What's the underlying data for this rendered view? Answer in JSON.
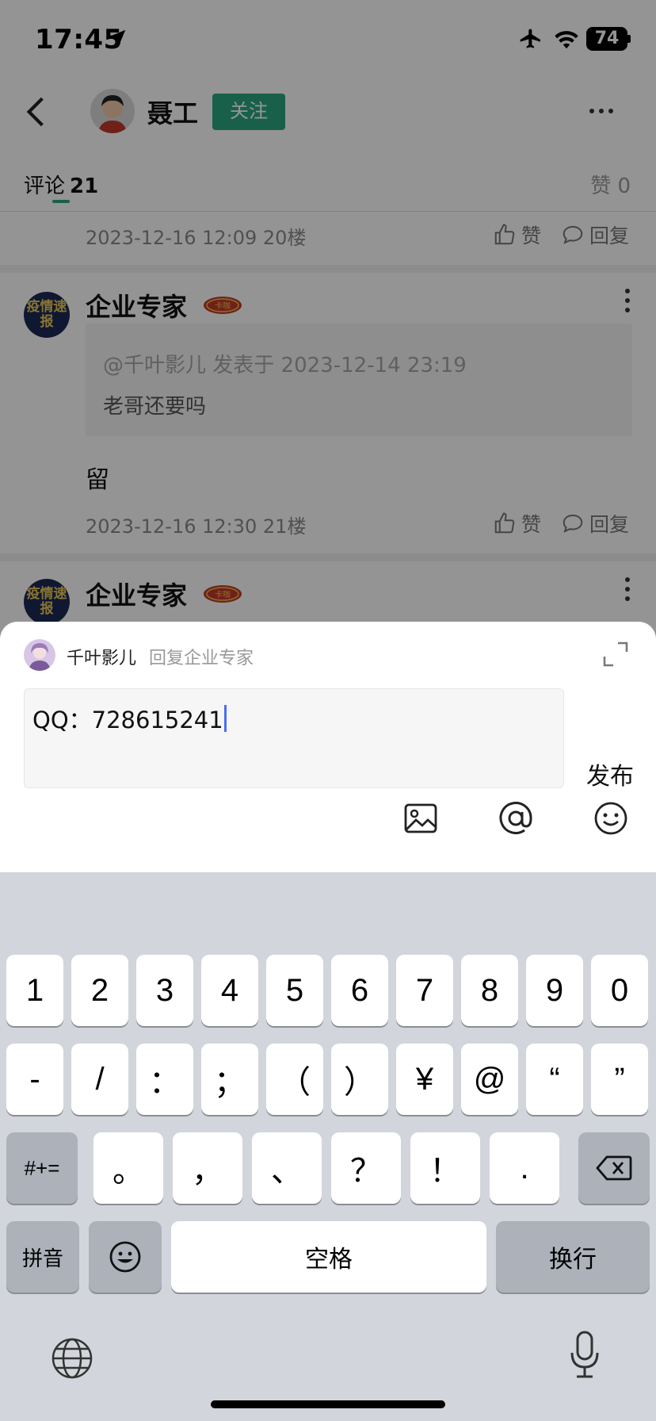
{
  "status_bar": {
    "time": "17:45",
    "battery": "74"
  },
  "header": {
    "author": "聂工",
    "follow": "关注"
  },
  "tabs": {
    "comments_label": "评论",
    "comments_count": "21",
    "likes": "赞 0"
  },
  "comments": [
    {
      "meta": "2023-12-16 12:09  20楼",
      "like": "赞",
      "reply": "回复"
    },
    {
      "name": "企业专家",
      "avatar_text": "疫情速报",
      "badge": "卡咖",
      "quote_meta": "@千叶影儿 发表于 2023-12-14 23:19",
      "quote_text": "老哥还要吗",
      "text": "留",
      "meta": "2023-12-16 12:30  21楼",
      "like": "赞",
      "reply": "回复"
    },
    {
      "name": "企业专家",
      "avatar_text": "疫情速报",
      "badge": "卡咖"
    }
  ],
  "reply_panel": {
    "user": "千叶影儿",
    "reply_to": "回复企业专家",
    "input_value": "QQ：728615241",
    "publish": "发布"
  },
  "keyboard": {
    "row1": [
      "1",
      "2",
      "3",
      "4",
      "5",
      "6",
      "7",
      "8",
      "9",
      "0"
    ],
    "row2": [
      "-",
      "/",
      "：",
      "；",
      "（",
      "）",
      "¥",
      "@",
      "“",
      "”"
    ],
    "row3": [
      "。",
      "，",
      "、",
      "？",
      "！",
      "."
    ],
    "symbols": "#+=",
    "pinyin": "拼音",
    "space": "空格",
    "return": "换行"
  },
  "colors": {
    "accent": "#2aa57e",
    "keyboard_bg": "#d2d5db",
    "caret": "#4a6cf7"
  }
}
